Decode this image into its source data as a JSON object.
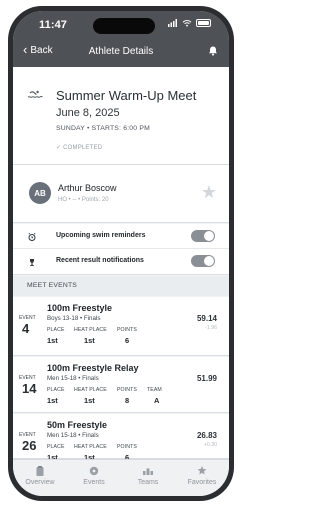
{
  "status_bar": {
    "time": "11:47",
    "battery_label": "70"
  },
  "nav": {
    "back_label": "Back",
    "title": "Athlete Details"
  },
  "meet": {
    "title": "Summer Warm-Up Meet",
    "date": "June 8, 2025",
    "day_line": "SUNDAY  •  STARTS: 6:00 PM",
    "status": "✓ COMPLETED"
  },
  "athlete": {
    "initials": "AB",
    "name": "Arthur Boscow",
    "meta": "HO  •  --  •  Points: 20"
  },
  "settings": [
    {
      "label": "Upcoming swim reminders",
      "enabled": true
    },
    {
      "label": "Recent result notifications",
      "enabled": true
    }
  ],
  "section_header": "MEET EVENTS",
  "events": [
    {
      "event_label": "EVENT",
      "event_number": "4",
      "name": "100m Freestyle",
      "subtitle": "Boys 13-18 • Finals",
      "metric_labels": {
        "place": "PLACE",
        "heat_place": "HEAT PLACE",
        "points": "POINTS",
        "team": ""
      },
      "place": "1st",
      "heat_place": "1st",
      "points": "6",
      "team": "",
      "time": "59.14",
      "diff": "-1.96"
    },
    {
      "event_label": "EVENT",
      "event_number": "14",
      "name": "100m Freestyle Relay",
      "subtitle": "Men 15-18 • Finals",
      "metric_labels": {
        "place": "PLACE",
        "heat_place": "HEAT PLACE",
        "points": "POINTS",
        "team": "TEAM"
      },
      "place": "1st",
      "heat_place": "1st",
      "points": "8",
      "team": "A",
      "time": "51.99",
      "diff": ""
    },
    {
      "event_label": "EVENT",
      "event_number": "26",
      "name": "50m Freestyle",
      "subtitle": "Men 15-18 • Finals",
      "metric_labels": {
        "place": "PLACE",
        "heat_place": "HEAT PLACE",
        "points": "POINTS",
        "team": ""
      },
      "place": "1st",
      "heat_place": "1st",
      "points": "6",
      "team": "",
      "time": "26.83",
      "diff": "+0.30"
    }
  ],
  "tabs": [
    {
      "label": "Overview",
      "icon": "clipboard-icon"
    },
    {
      "label": "Events",
      "icon": "events-icon"
    },
    {
      "label": "Teams",
      "icon": "teams-icon"
    },
    {
      "label": "Favorites",
      "icon": "star-icon"
    }
  ],
  "colors": {
    "phone_frame": "#2b2d30",
    "header_bg": "#4e5156",
    "toggle_on": "#8a8f95",
    "section_bg": "#eaedf0"
  }
}
